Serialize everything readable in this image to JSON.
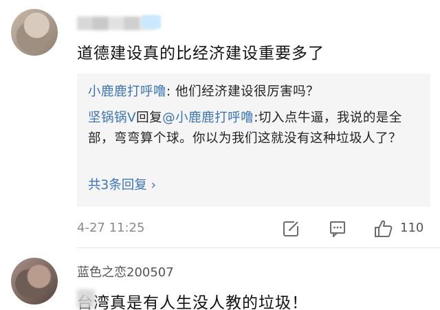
{
  "comments": [
    {
      "text": "道德建设真的比经济建设重要多了",
      "replies": [
        {
          "author": "小鹿鹿打呼噜",
          "sep": ":",
          "text": " 他们经济建设很厉害吗？"
        },
        {
          "author": "坚锅锅V",
          "reply_word": "回复",
          "mention": "@小鹿鹿打呼噜",
          "text": ":切入点牛逼，我说的是全部，弯弯算个球。你以为我们这就没有这种垃圾人了？"
        }
      ],
      "more_replies": "共3条回复 ›",
      "timestamp": "4-27 11:25",
      "like_count": "110"
    },
    {
      "author": "蓝色之恋200507",
      "text": "台湾真是有人生没人教的垃圾！"
    }
  ],
  "icons": {
    "share": "share-icon",
    "comment": "comment-icon",
    "like": "thumbs-up-icon"
  },
  "colors": {
    "link": "#3a74b5",
    "reply_background": "#f5f5f5",
    "meta_text": "#8a8a8a"
  }
}
